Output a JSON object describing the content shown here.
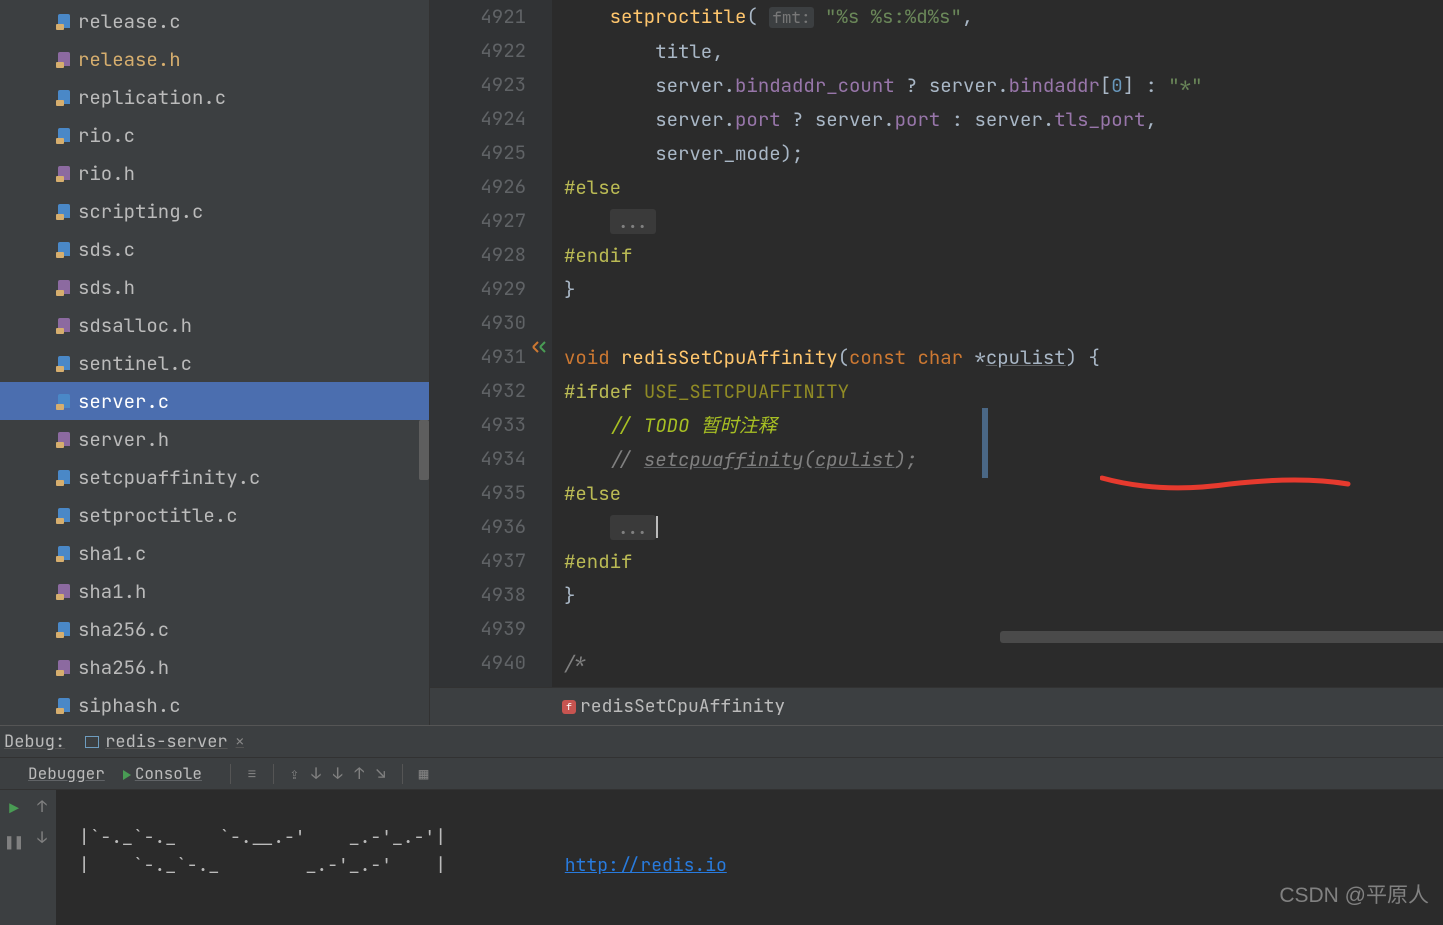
{
  "sidebar": {
    "files": [
      {
        "name": "release.c",
        "type": "c"
      },
      {
        "name": "release.h",
        "type": "h",
        "modified": true
      },
      {
        "name": "replication.c",
        "type": "c"
      },
      {
        "name": "rio.c",
        "type": "c"
      },
      {
        "name": "rio.h",
        "type": "h"
      },
      {
        "name": "scripting.c",
        "type": "c"
      },
      {
        "name": "sds.c",
        "type": "c"
      },
      {
        "name": "sds.h",
        "type": "h"
      },
      {
        "name": "sdsalloc.h",
        "type": "h"
      },
      {
        "name": "sentinel.c",
        "type": "c"
      },
      {
        "name": "server.c",
        "type": "c",
        "selected": true
      },
      {
        "name": "server.h",
        "type": "h"
      },
      {
        "name": "setcpuaffinity.c",
        "type": "c"
      },
      {
        "name": "setproctitle.c",
        "type": "c"
      },
      {
        "name": "sha1.c",
        "type": "c"
      },
      {
        "name": "sha1.h",
        "type": "h"
      },
      {
        "name": "sha256.c",
        "type": "c"
      },
      {
        "name": "sha256.h",
        "type": "h"
      },
      {
        "name": "siphash.c",
        "type": "c"
      }
    ]
  },
  "editor": {
    "line_start": 4921,
    "line_end": 4940,
    "breadcrumb": "redisSetCpuAffinity",
    "code": {
      "l4921_fn": "setproctitle",
      "l4921_hint": "fmt:",
      "l4921_str": "\"%s %s:%d%s\"",
      "l4922_ident": "title",
      "l4923_a": "server",
      "l4923_b": "bindaddr_count",
      "l4923_c": "server",
      "l4923_d": "bindaddr",
      "l4923_idx": "0",
      "l4923_e": "\"*\"",
      "l4924_a": "server",
      "l4924_b": "port",
      "l4924_c": "server",
      "l4924_d": "port",
      "l4924_e": "server",
      "l4924_f": "tls_port",
      "l4925_a": "server_mode",
      "l4926": "#else",
      "l4927": "...",
      "l4928": "#endif",
      "l4931_kw1": "void",
      "l4931_name": "redisSetCpuAffinity",
      "l4931_kw2": "const",
      "l4931_kw3": "char",
      "l4931_param": "cpulist",
      "l4932_a": "#ifdef",
      "l4932_b": "USE_SETCPUAFFINITY",
      "l4933": "// TODO 暂时注释",
      "l4934_a": "// ",
      "l4934_b": "setcpuaffinity",
      "l4934_c": "cpulist",
      "l4935": "#else",
      "l4936": "...",
      "l4937": "#endif",
      "l4940": "/*"
    }
  },
  "debug": {
    "title": "Debug:",
    "config": "redis-server",
    "tab_debugger": "Debugger",
    "tab_console": "Console",
    "ascii1": " |`-._`-._    `-.__.-'    _.-'_.-'|",
    "ascii2": " |    `-._`-._        _.-'_.-'    |           ",
    "url": "http://redis.io"
  },
  "watermark": "CSDN @平原人"
}
